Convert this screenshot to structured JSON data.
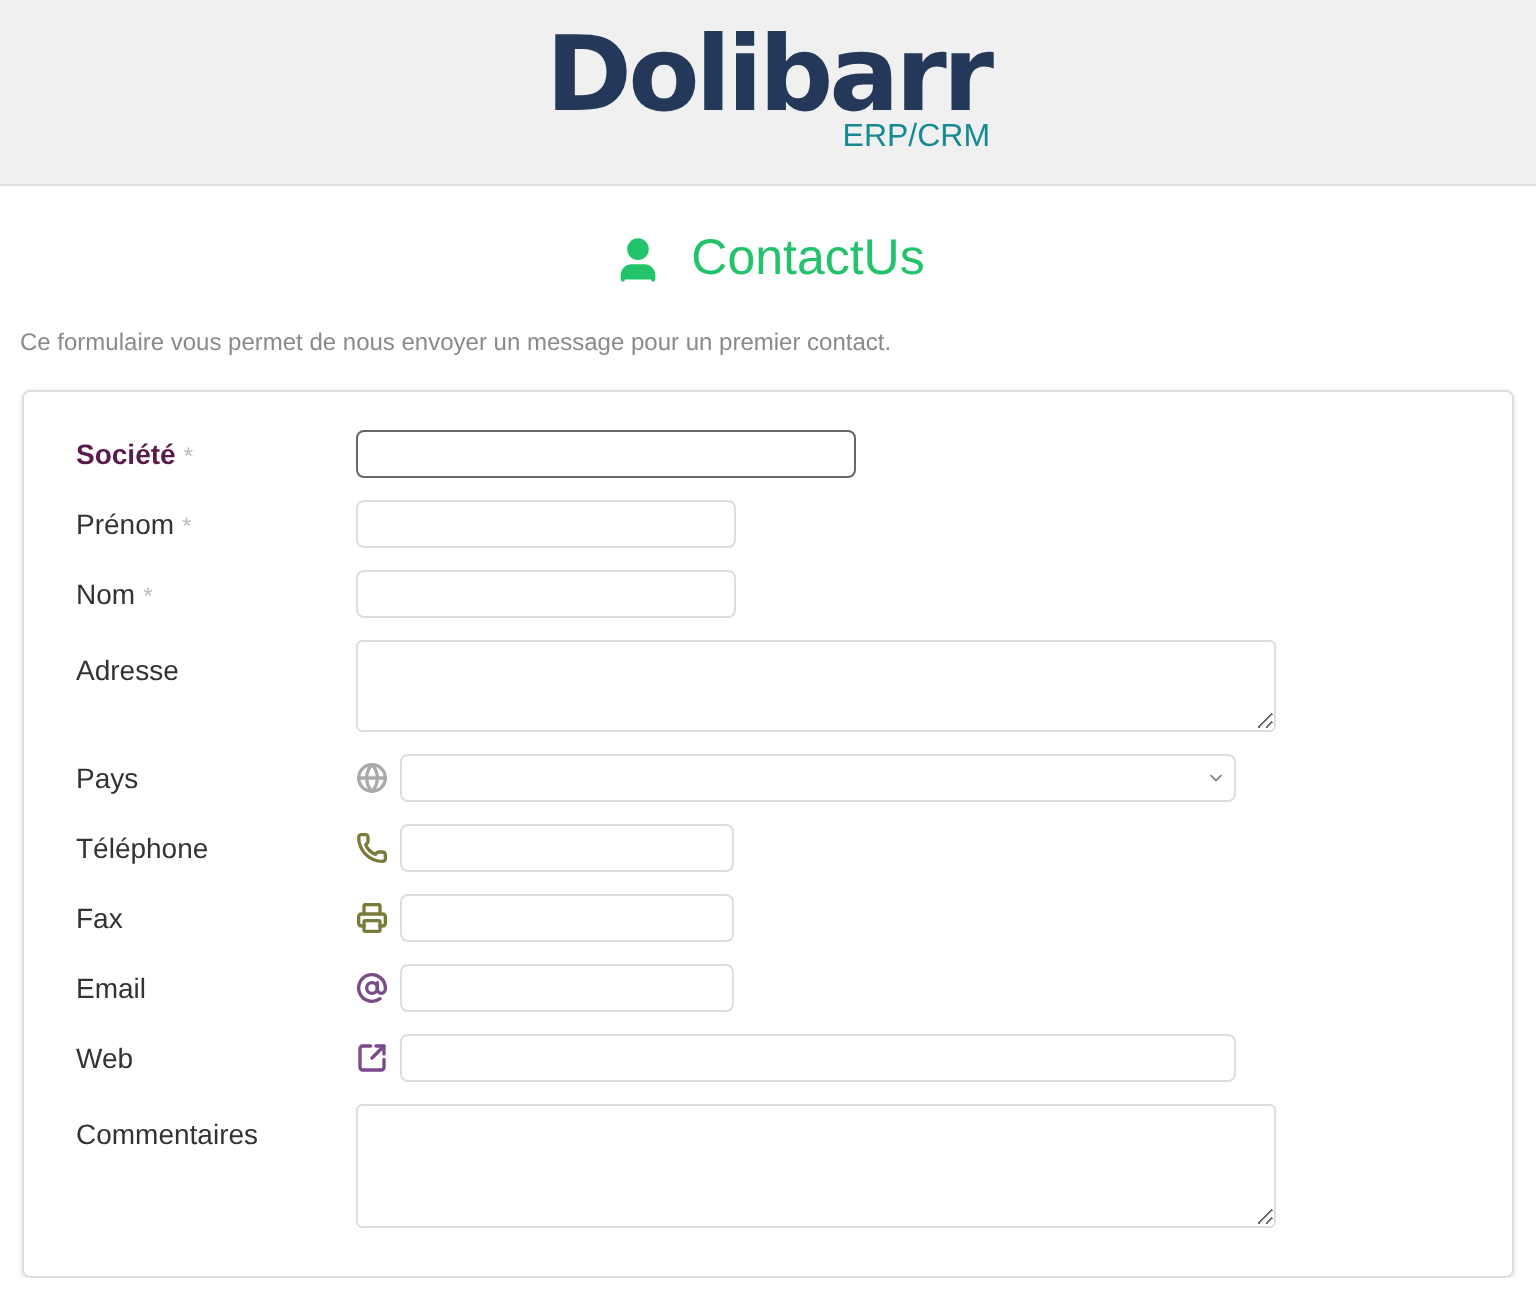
{
  "header": {
    "logo": "Dolibarr",
    "logo_tag": "ERP/CRM"
  },
  "title": "ContactUs",
  "description": "Ce formulaire vous permet de nous envoyer un message pour un premier contact.",
  "fields": [
    {
      "label": "Société",
      "mark": "*",
      "kind": "text",
      "focused": true
    },
    {
      "label": "Prénom",
      "mark": "*",
      "kind": "text",
      "focused": false
    },
    {
      "label": "Nom",
      "mark": "*",
      "kind": "text",
      "focused": false
    },
    {
      "label": "Adresse",
      "kind": "textarea",
      "focused": false
    },
    {
      "label": "Pays",
      "kind": "select",
      "focused": false
    },
    {
      "label": "Téléphone",
      "kind": "text",
      "focused": false
    },
    {
      "label": "Fax",
      "kind": "text",
      "focused": false
    },
    {
      "label": "Email",
      "kind": "text",
      "focused": false
    },
    {
      "label": "Web",
      "kind": "text",
      "focused": false
    },
    {
      "label": "Commentaires",
      "kind": "textarea",
      "focused": false
    }
  ]
}
